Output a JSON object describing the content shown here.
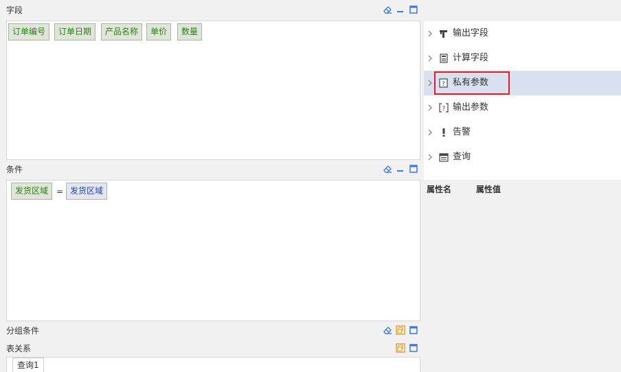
{
  "fields_section": {
    "title": "字段",
    "chips": [
      "订单编号",
      "订单日期",
      "产品名称",
      "单价",
      "数量"
    ]
  },
  "conditions_section": {
    "title": "条件",
    "left_operand": "发货区域",
    "operator": "=",
    "right_operand": "发货区域"
  },
  "group_section": {
    "title": "分组条件"
  },
  "relations_section": {
    "title": "表关系",
    "tab_label": "查询1"
  },
  "tree": {
    "items": [
      {
        "label": "输出字段",
        "icon": "output-field-icon"
      },
      {
        "label": "计算字段",
        "icon": "calculator-icon"
      },
      {
        "label": "私有参数",
        "icon": "private-param-icon",
        "selected": true
      },
      {
        "label": "输出参数",
        "icon": "output-param-icon"
      },
      {
        "label": "告警",
        "icon": "alert-icon"
      },
      {
        "label": "查询",
        "icon": "query-icon"
      }
    ]
  },
  "properties": {
    "name_col": "属性名",
    "value_col": "属性值"
  },
  "colors": {
    "selected_bg": "#d9e1f0",
    "highlight_border": "#e21b23",
    "chip_text": "#2e7d1a",
    "param_text": "#2444c9",
    "tool_blue": "#3d7ad8",
    "tool_orange": "#e79b25"
  }
}
